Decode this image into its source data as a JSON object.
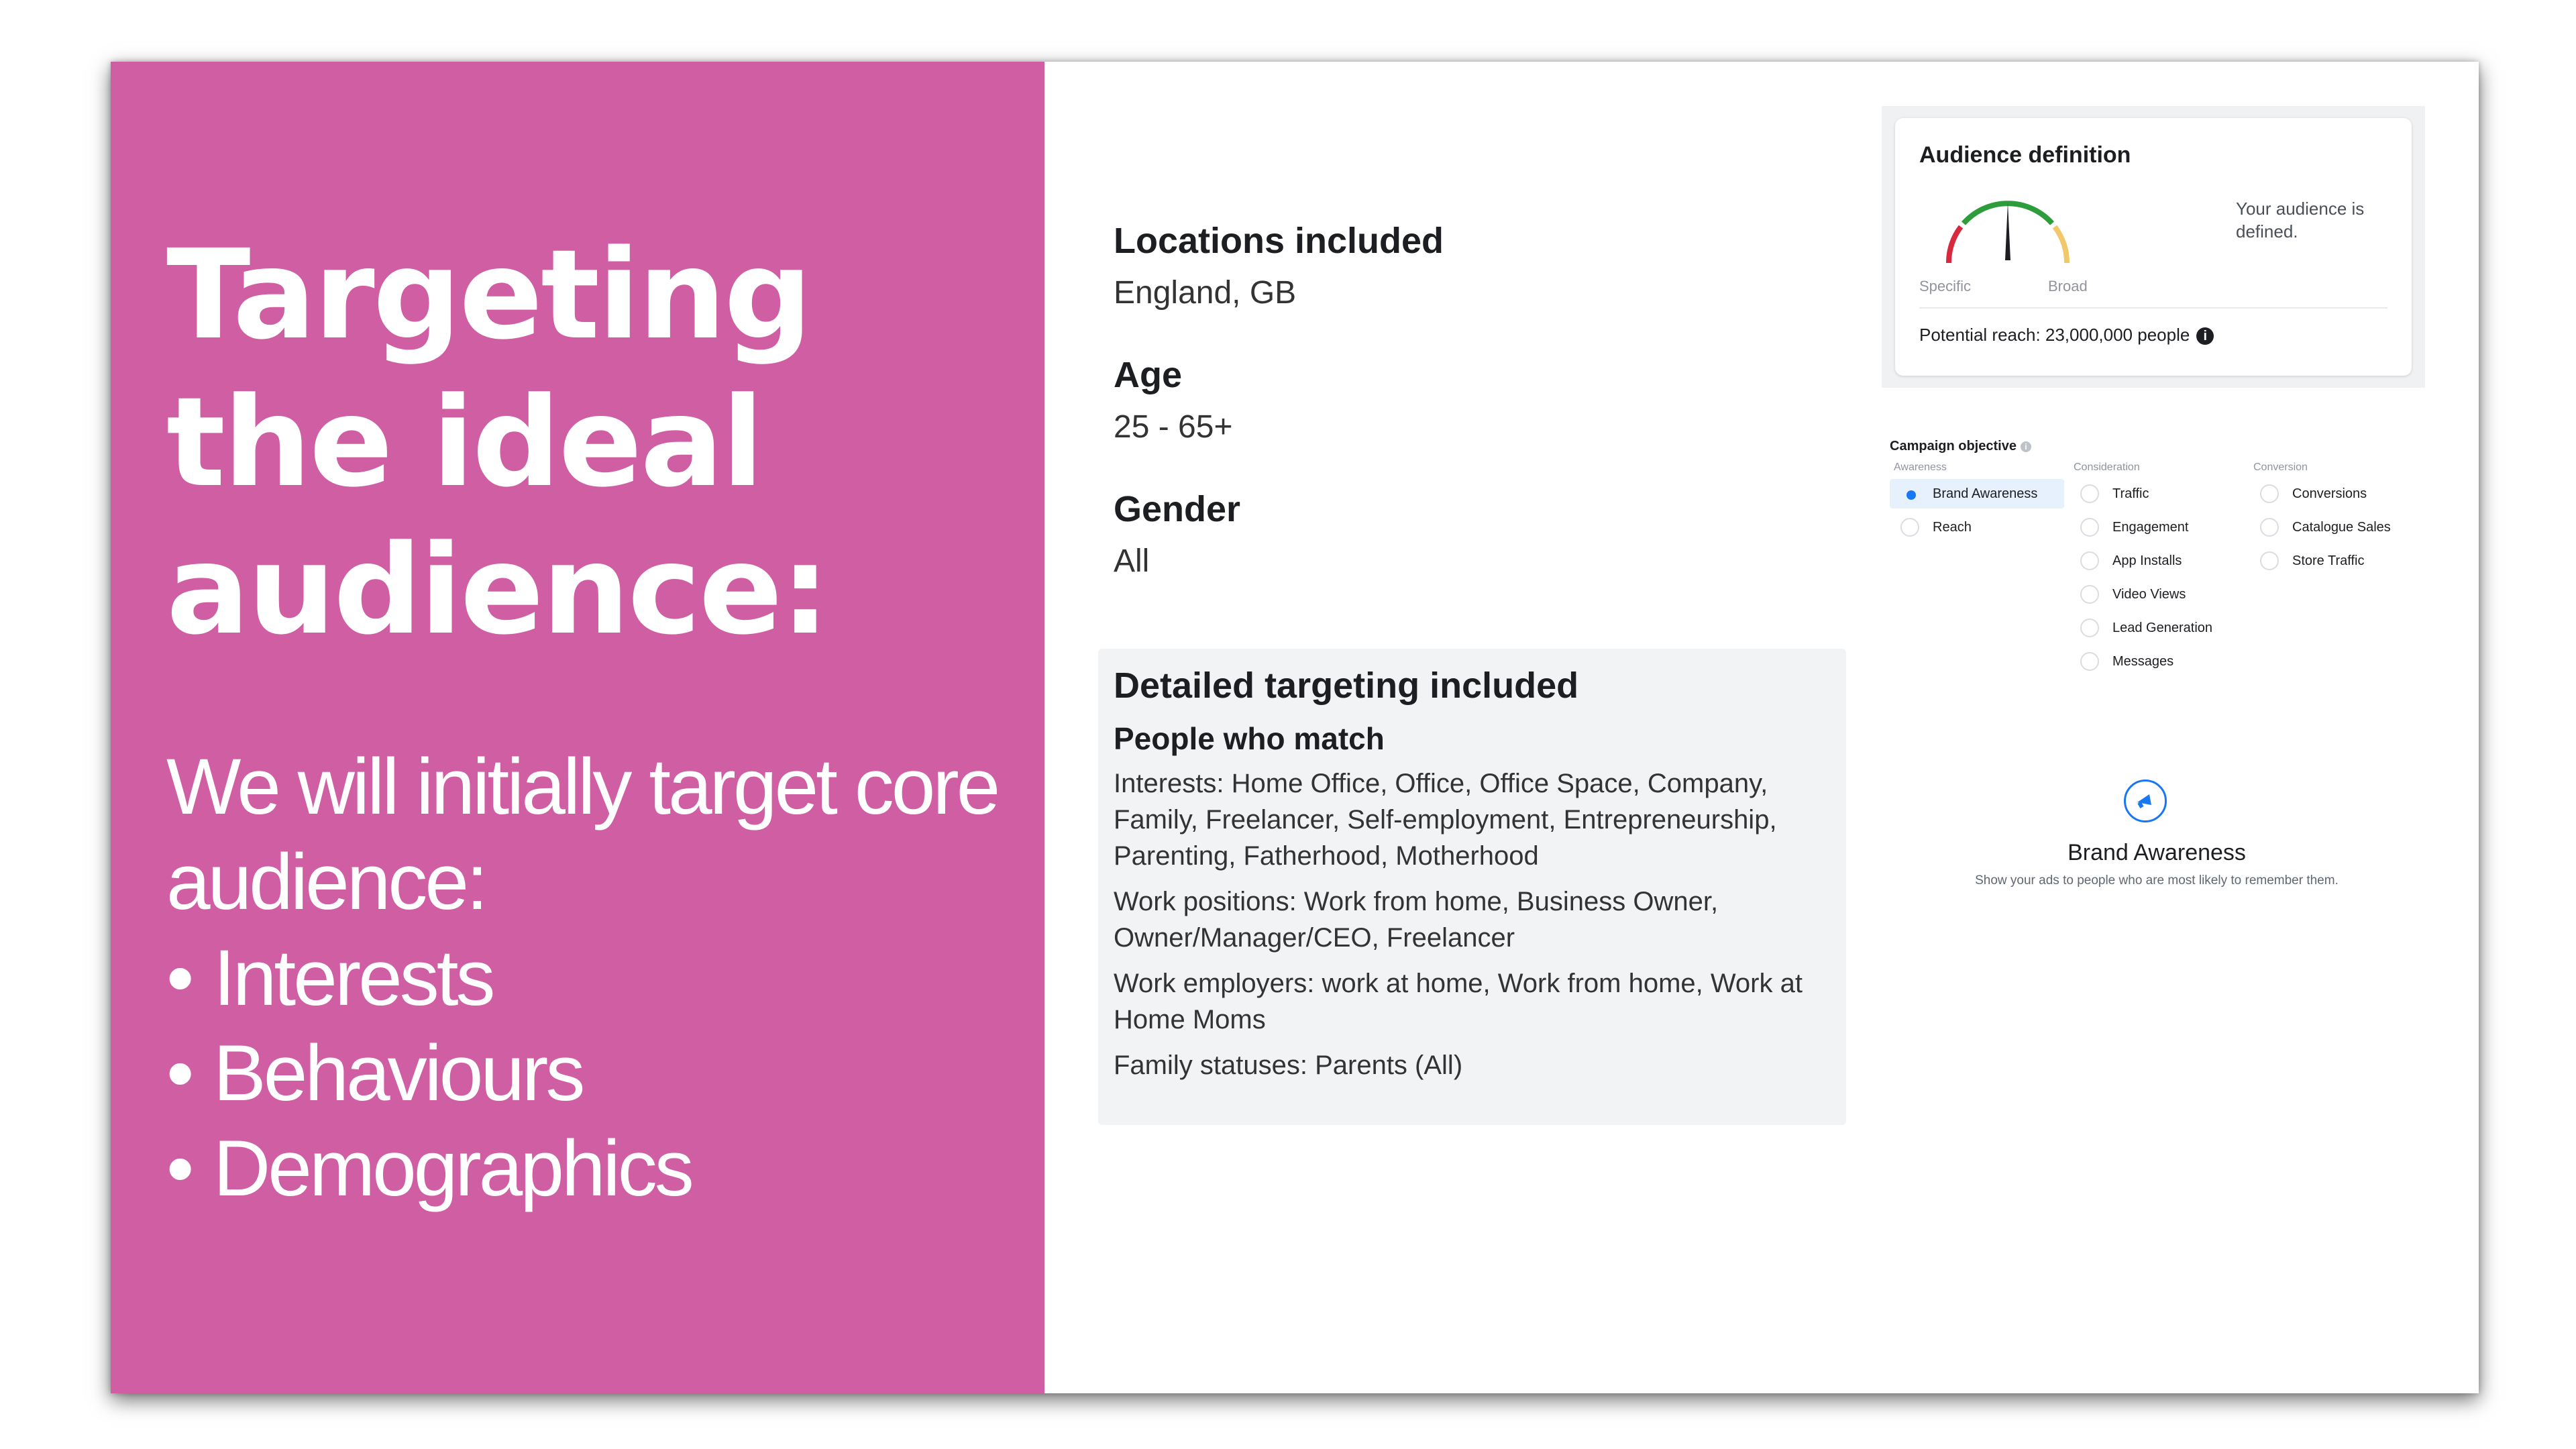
{
  "slide": {
    "title_lines": [
      "Targeting",
      "the ideal",
      "audience:"
    ],
    "intro": "We will initially target core audience:",
    "bullets": [
      "Interests",
      "Behaviours",
      "Demographics"
    ]
  },
  "targeting": {
    "locations_label": "Locations included",
    "locations_value": "England, GB",
    "age_label": "Age",
    "age_value": "25 - 65+",
    "gender_label": "Gender",
    "gender_value": "All",
    "detailed_title": "Detailed targeting included",
    "people_who_match": "People who match",
    "lines": [
      "Interests: Home Office, Office, Office Space, Company, Family, Freelancer, Self-employment, Entrepreneurship, Parenting, Fatherhood, Motherhood",
      "Work positions: Work from home, Business Owner, Owner/Manager/CEO, Freelancer",
      "Work employers: work at home, Work from home, Work at Home Moms",
      "Family statuses: Parents (All)"
    ]
  },
  "audience_definition": {
    "title": "Audience definition",
    "gauge_left_label": "Specific",
    "gauge_right_label": "Broad",
    "status": "Your audience is defined.",
    "reach": "Potential reach: 23,000,000 people",
    "info_icon": "i",
    "gauge_level": 0.5
  },
  "campaign_objective": {
    "title": "Campaign objective",
    "info_icon": "i",
    "columns": [
      {
        "heading": "Awareness",
        "options": [
          "Brand Awareness",
          "Reach"
        ]
      },
      {
        "heading": "Consideration",
        "options": [
          "Traffic",
          "Engagement",
          "App Installs",
          "Video Views",
          "Lead Generation",
          "Messages"
        ]
      },
      {
        "heading": "Conversion",
        "options": [
          "Conversions",
          "Catalogue Sales",
          "Store Traffic"
        ]
      }
    ],
    "selected": "Brand Awareness",
    "selected_title": "Brand Awareness",
    "selected_description": "Show your ads to people who are most likely to remember them."
  },
  "colors": {
    "accent_pink": "#d05ea3",
    "facebook_blue": "#1877f2"
  }
}
